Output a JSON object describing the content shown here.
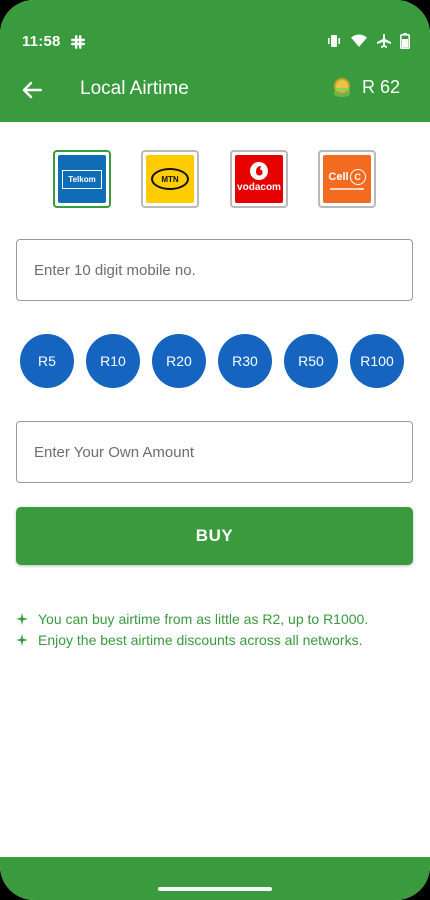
{
  "status_bar": {
    "time": "11:58",
    "icons": [
      "slack-icon",
      "vibrate-icon",
      "wifi-icon",
      "airplane-icon",
      "battery-icon"
    ]
  },
  "app_bar": {
    "title": "Local Airtime",
    "back_icon": "arrow-left-icon",
    "balance": "R 62",
    "balance_icon": "wallet-money-icon"
  },
  "networks": [
    {
      "id": "telkom",
      "label": "Telkom",
      "selected": true
    },
    {
      "id": "mtn",
      "label": "MTN",
      "selected": false
    },
    {
      "id": "vodacom",
      "label": "vodacom",
      "selected": false
    },
    {
      "id": "cellc",
      "label": "Cell C",
      "selected": false
    }
  ],
  "phone_input": {
    "value": "",
    "placeholder": "Enter 10 digit mobile no."
  },
  "amounts": [
    "R5",
    "R10",
    "R20",
    "R30",
    "R50",
    "R100"
  ],
  "custom_amount_input": {
    "value": "",
    "placeholder": "Enter Your Own Amount"
  },
  "buy_button": {
    "label": "BUY"
  },
  "notes": [
    "You can buy airtime from as little as R2, up to R1000.",
    "Enjoy the best airtime discounts across all networks."
  ],
  "colors": {
    "primary_green": "#3a9a3e",
    "amount_blue": "#1565c0",
    "telkom_blue": "#0f6db8",
    "mtn_yellow": "#ffcc00",
    "vodacom_red": "#e60000",
    "cellc_orange": "#f36b21"
  }
}
